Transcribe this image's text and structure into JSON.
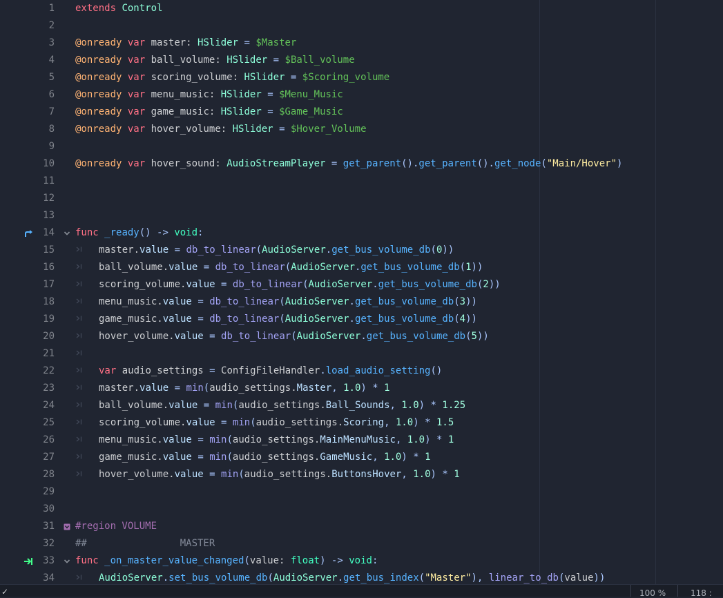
{
  "lines": [
    {
      "n": "1",
      "segs": [
        [
          "k",
          "extends"
        ],
        [
          "plain",
          " "
        ],
        [
          "c",
          "Control"
        ]
      ]
    },
    {
      "n": "2",
      "segs": []
    },
    {
      "n": "3",
      "segs": [
        [
          "ann",
          "@onready"
        ],
        [
          "plain",
          " "
        ],
        [
          "k",
          "var"
        ],
        [
          "plain",
          " master: "
        ],
        [
          "c",
          "HSlider"
        ],
        [
          "plain",
          " "
        ],
        [
          "p",
          "="
        ],
        [
          "plain",
          " "
        ],
        [
          "n",
          "$Master"
        ]
      ]
    },
    {
      "n": "4",
      "segs": [
        [
          "ann",
          "@onready"
        ],
        [
          "plain",
          " "
        ],
        [
          "k",
          "var"
        ],
        [
          "plain",
          " ball_volume: "
        ],
        [
          "c",
          "HSlider"
        ],
        [
          "plain",
          " "
        ],
        [
          "p",
          "="
        ],
        [
          "plain",
          " "
        ],
        [
          "n",
          "$Ball_volume"
        ]
      ]
    },
    {
      "n": "5",
      "segs": [
        [
          "ann",
          "@onready"
        ],
        [
          "plain",
          " "
        ],
        [
          "k",
          "var"
        ],
        [
          "plain",
          " scoring_volume: "
        ],
        [
          "c",
          "HSlider"
        ],
        [
          "plain",
          " "
        ],
        [
          "p",
          "="
        ],
        [
          "plain",
          " "
        ],
        [
          "n",
          "$Scoring_volume"
        ]
      ]
    },
    {
      "n": "6",
      "segs": [
        [
          "ann",
          "@onready"
        ],
        [
          "plain",
          " "
        ],
        [
          "k",
          "var"
        ],
        [
          "plain",
          " menu_music: "
        ],
        [
          "c",
          "HSlider"
        ],
        [
          "plain",
          " "
        ],
        [
          "p",
          "="
        ],
        [
          "plain",
          " "
        ],
        [
          "n",
          "$Menu_Music"
        ]
      ]
    },
    {
      "n": "7",
      "segs": [
        [
          "ann",
          "@onready"
        ],
        [
          "plain",
          " "
        ],
        [
          "k",
          "var"
        ],
        [
          "plain",
          " game_music: "
        ],
        [
          "c",
          "HSlider"
        ],
        [
          "plain",
          " "
        ],
        [
          "p",
          "="
        ],
        [
          "plain",
          " "
        ],
        [
          "n",
          "$Game_Music"
        ]
      ]
    },
    {
      "n": "8",
      "segs": [
        [
          "ann",
          "@onready"
        ],
        [
          "plain",
          " "
        ],
        [
          "k",
          "var"
        ],
        [
          "plain",
          " hover_volume: "
        ],
        [
          "c",
          "HSlider"
        ],
        [
          "plain",
          " "
        ],
        [
          "p",
          "="
        ],
        [
          "plain",
          " "
        ],
        [
          "n",
          "$Hover_Volume"
        ]
      ]
    },
    {
      "n": "9",
      "segs": []
    },
    {
      "n": "10",
      "segs": [
        [
          "ann",
          "@onready"
        ],
        [
          "plain",
          " "
        ],
        [
          "k",
          "var"
        ],
        [
          "plain",
          " hover_sound: "
        ],
        [
          "c",
          "AudioStreamPlayer"
        ],
        [
          "plain",
          " "
        ],
        [
          "p",
          "="
        ],
        [
          "plain",
          " "
        ],
        [
          "f",
          "get_parent"
        ],
        [
          "p",
          "()."
        ],
        [
          "f",
          "get_parent"
        ],
        [
          "p",
          "()."
        ],
        [
          "f",
          "get_node"
        ],
        [
          "p",
          "("
        ],
        [
          "s",
          "\"Main/Hover\""
        ],
        [
          "p",
          ")"
        ]
      ]
    },
    {
      "n": "11",
      "segs": []
    },
    {
      "n": "12",
      "segs": []
    },
    {
      "n": "13",
      "segs": []
    },
    {
      "n": "14",
      "mark": "override",
      "fold": "v",
      "segs": [
        [
          "k",
          "func"
        ],
        [
          "plain",
          " "
        ],
        [
          "f",
          "_ready"
        ],
        [
          "p",
          "() -> "
        ],
        [
          "t",
          "void"
        ],
        [
          "p",
          ":"
        ]
      ]
    },
    {
      "n": "15",
      "tab": true,
      "segs": [
        [
          "plain",
          "master."
        ],
        [
          "mem",
          "value"
        ],
        [
          "plain",
          " "
        ],
        [
          "p",
          "="
        ],
        [
          "plain",
          " "
        ],
        [
          "bf",
          "db_to_linear"
        ],
        [
          "p",
          "("
        ],
        [
          "c",
          "AudioServer"
        ],
        [
          "p",
          "."
        ],
        [
          "f",
          "get_bus_volume_db"
        ],
        [
          "p",
          "("
        ],
        [
          "num",
          "0"
        ],
        [
          "p",
          "))"
        ]
      ]
    },
    {
      "n": "16",
      "tab": true,
      "segs": [
        [
          "plain",
          "ball_volume."
        ],
        [
          "mem",
          "value"
        ],
        [
          "plain",
          " "
        ],
        [
          "p",
          "="
        ],
        [
          "plain",
          " "
        ],
        [
          "bf",
          "db_to_linear"
        ],
        [
          "p",
          "("
        ],
        [
          "c",
          "AudioServer"
        ],
        [
          "p",
          "."
        ],
        [
          "f",
          "get_bus_volume_db"
        ],
        [
          "p",
          "("
        ],
        [
          "num",
          "1"
        ],
        [
          "p",
          "))"
        ]
      ]
    },
    {
      "n": "17",
      "tab": true,
      "segs": [
        [
          "plain",
          "scoring_volume."
        ],
        [
          "mem",
          "value"
        ],
        [
          "plain",
          " "
        ],
        [
          "p",
          "="
        ],
        [
          "plain",
          " "
        ],
        [
          "bf",
          "db_to_linear"
        ],
        [
          "p",
          "("
        ],
        [
          "c",
          "AudioServer"
        ],
        [
          "p",
          "."
        ],
        [
          "f",
          "get_bus_volume_db"
        ],
        [
          "p",
          "("
        ],
        [
          "num",
          "2"
        ],
        [
          "p",
          "))"
        ]
      ]
    },
    {
      "n": "18",
      "tab": true,
      "segs": [
        [
          "plain",
          "menu_music."
        ],
        [
          "mem",
          "value"
        ],
        [
          "plain",
          " "
        ],
        [
          "p",
          "="
        ],
        [
          "plain",
          " "
        ],
        [
          "bf",
          "db_to_linear"
        ],
        [
          "p",
          "("
        ],
        [
          "c",
          "AudioServer"
        ],
        [
          "p",
          "."
        ],
        [
          "f",
          "get_bus_volume_db"
        ],
        [
          "p",
          "("
        ],
        [
          "num",
          "3"
        ],
        [
          "p",
          "))"
        ]
      ]
    },
    {
      "n": "19",
      "tab": true,
      "segs": [
        [
          "plain",
          "game_music."
        ],
        [
          "mem",
          "value"
        ],
        [
          "plain",
          " "
        ],
        [
          "p",
          "="
        ],
        [
          "plain",
          " "
        ],
        [
          "bf",
          "db_to_linear"
        ],
        [
          "p",
          "("
        ],
        [
          "c",
          "AudioServer"
        ],
        [
          "p",
          "."
        ],
        [
          "f",
          "get_bus_volume_db"
        ],
        [
          "p",
          "("
        ],
        [
          "num",
          "4"
        ],
        [
          "p",
          "))"
        ]
      ]
    },
    {
      "n": "20",
      "tab": true,
      "segs": [
        [
          "plain",
          "hover_volume."
        ],
        [
          "mem",
          "value"
        ],
        [
          "plain",
          " "
        ],
        [
          "p",
          "="
        ],
        [
          "plain",
          " "
        ],
        [
          "bf",
          "db_to_linear"
        ],
        [
          "p",
          "("
        ],
        [
          "c",
          "AudioServer"
        ],
        [
          "p",
          "."
        ],
        [
          "f",
          "get_bus_volume_db"
        ],
        [
          "p",
          "("
        ],
        [
          "num",
          "5"
        ],
        [
          "p",
          "))"
        ]
      ]
    },
    {
      "n": "21",
      "tab": true,
      "segs": []
    },
    {
      "n": "22",
      "tab": true,
      "segs": [
        [
          "k",
          "var"
        ],
        [
          "plain",
          " audio_settings "
        ],
        [
          "p",
          "="
        ],
        [
          "plain",
          " ConfigFileHandler"
        ],
        [
          "p",
          "."
        ],
        [
          "f",
          "load_audio_setting"
        ],
        [
          "p",
          "()"
        ]
      ]
    },
    {
      "n": "23",
      "tab": true,
      "segs": [
        [
          "plain",
          "master."
        ],
        [
          "mem",
          "value"
        ],
        [
          "plain",
          " "
        ],
        [
          "p",
          "="
        ],
        [
          "plain",
          " "
        ],
        [
          "bf",
          "min"
        ],
        [
          "p",
          "("
        ],
        [
          "plain",
          "audio_settings."
        ],
        [
          "mem",
          "Master"
        ],
        [
          "p",
          ", "
        ],
        [
          "num",
          "1.0"
        ],
        [
          "p",
          ")"
        ],
        [
          "plain",
          " "
        ],
        [
          "p",
          "*"
        ],
        [
          "plain",
          " "
        ],
        [
          "num",
          "1"
        ]
      ]
    },
    {
      "n": "24",
      "tab": true,
      "segs": [
        [
          "plain",
          "ball_volume."
        ],
        [
          "mem",
          "value"
        ],
        [
          "plain",
          " "
        ],
        [
          "p",
          "="
        ],
        [
          "plain",
          " "
        ],
        [
          "bf",
          "min"
        ],
        [
          "p",
          "("
        ],
        [
          "plain",
          "audio_settings."
        ],
        [
          "mem",
          "Ball_Sounds"
        ],
        [
          "p",
          ", "
        ],
        [
          "num",
          "1.0"
        ],
        [
          "p",
          ")"
        ],
        [
          "plain",
          " "
        ],
        [
          "p",
          "*"
        ],
        [
          "plain",
          " "
        ],
        [
          "num",
          "1.25"
        ]
      ]
    },
    {
      "n": "25",
      "tab": true,
      "segs": [
        [
          "plain",
          "scoring_volume."
        ],
        [
          "mem",
          "value"
        ],
        [
          "plain",
          " "
        ],
        [
          "p",
          "="
        ],
        [
          "plain",
          " "
        ],
        [
          "bf",
          "min"
        ],
        [
          "p",
          "("
        ],
        [
          "plain",
          "audio_settings."
        ],
        [
          "mem",
          "Scoring"
        ],
        [
          "p",
          ", "
        ],
        [
          "num",
          "1.0"
        ],
        [
          "p",
          ")"
        ],
        [
          "plain",
          " "
        ],
        [
          "p",
          "*"
        ],
        [
          "plain",
          " "
        ],
        [
          "num",
          "1.5"
        ]
      ]
    },
    {
      "n": "26",
      "tab": true,
      "segs": [
        [
          "plain",
          "menu_music."
        ],
        [
          "mem",
          "value"
        ],
        [
          "plain",
          " "
        ],
        [
          "p",
          "="
        ],
        [
          "plain",
          " "
        ],
        [
          "bf",
          "min"
        ],
        [
          "p",
          "("
        ],
        [
          "plain",
          "audio_settings."
        ],
        [
          "mem",
          "MainMenuMusic"
        ],
        [
          "p",
          ", "
        ],
        [
          "num",
          "1.0"
        ],
        [
          "p",
          ")"
        ],
        [
          "plain",
          " "
        ],
        [
          "p",
          "*"
        ],
        [
          "plain",
          " "
        ],
        [
          "num",
          "1"
        ]
      ]
    },
    {
      "n": "27",
      "tab": true,
      "segs": [
        [
          "plain",
          "game_music."
        ],
        [
          "mem",
          "value"
        ],
        [
          "plain",
          " "
        ],
        [
          "p",
          "="
        ],
        [
          "plain",
          " "
        ],
        [
          "bf",
          "min"
        ],
        [
          "p",
          "("
        ],
        [
          "plain",
          "audio_settings."
        ],
        [
          "mem",
          "GameMusic"
        ],
        [
          "p",
          ", "
        ],
        [
          "num",
          "1.0"
        ],
        [
          "p",
          ")"
        ],
        [
          "plain",
          " "
        ],
        [
          "p",
          "*"
        ],
        [
          "plain",
          " "
        ],
        [
          "num",
          "1"
        ]
      ]
    },
    {
      "n": "28",
      "tab": true,
      "segs": [
        [
          "plain",
          "hover_volume."
        ],
        [
          "mem",
          "value"
        ],
        [
          "plain",
          " "
        ],
        [
          "p",
          "="
        ],
        [
          "plain",
          " "
        ],
        [
          "bf",
          "min"
        ],
        [
          "p",
          "("
        ],
        [
          "plain",
          "audio_settings."
        ],
        [
          "mem",
          "ButtonsHover"
        ],
        [
          "p",
          ", "
        ],
        [
          "num",
          "1.0"
        ],
        [
          "p",
          ")"
        ],
        [
          "plain",
          " "
        ],
        [
          "p",
          "*"
        ],
        [
          "plain",
          " "
        ],
        [
          "num",
          "1"
        ]
      ]
    },
    {
      "n": "29",
      "segs": []
    },
    {
      "n": "30",
      "segs": []
    },
    {
      "n": "31",
      "fold": "region",
      "segs": [
        [
          "rg",
          "#region VOLUME"
        ]
      ]
    },
    {
      "n": "32",
      "segs": [
        [
          "cm",
          "##                MASTER"
        ]
      ]
    },
    {
      "n": "33",
      "mark": "signal",
      "fold": "v",
      "segs": [
        [
          "k",
          "func"
        ],
        [
          "plain",
          " "
        ],
        [
          "f",
          "_on_master_value_changed"
        ],
        [
          "p",
          "("
        ],
        [
          "plain",
          "value: "
        ],
        [
          "t",
          "float"
        ],
        [
          "p",
          ") -> "
        ],
        [
          "t",
          "void"
        ],
        [
          "p",
          ":"
        ]
      ]
    },
    {
      "n": "34",
      "tab": true,
      "segs": [
        [
          "c",
          "AudioServer"
        ],
        [
          "p",
          "."
        ],
        [
          "f",
          "set_bus_volume_db"
        ],
        [
          "p",
          "("
        ],
        [
          "c",
          "AudioServer"
        ],
        [
          "p",
          "."
        ],
        [
          "f",
          "get_bus_index"
        ],
        [
          "p",
          "("
        ],
        [
          "s",
          "\"Master\""
        ],
        [
          "p",
          "), "
        ],
        [
          "bf",
          "linear_to_db"
        ],
        [
          "p",
          "("
        ],
        [
          "plain",
          "value"
        ],
        [
          "p",
          "))"
        ]
      ]
    }
  ],
  "status": {
    "zoom": "100 %",
    "position": "118 :"
  },
  "icons": {
    "override": "override-arrow-icon",
    "signal": "signal-connection-icon",
    "fold": "chevron-down-icon",
    "region": "region-fold-icon",
    "tab": "tab-indent-icon"
  },
  "colors": {
    "background": "#202531",
    "keyword": "#ff7085",
    "annotation": "#ffb373",
    "type": "#42ffc2",
    "node_path": "#63c259",
    "function": "#57b3ff",
    "string": "#ffeda1",
    "number": "#a1ffe0"
  }
}
